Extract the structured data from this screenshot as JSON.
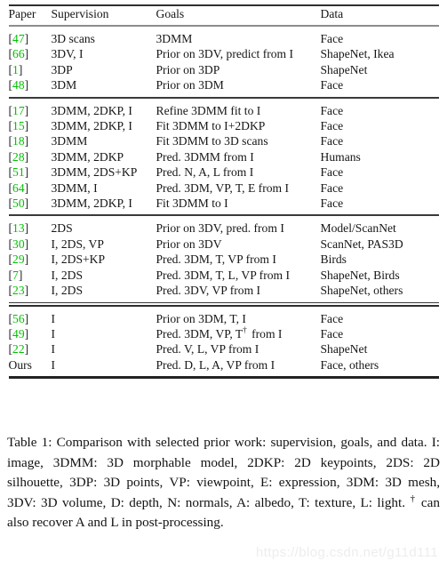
{
  "table": {
    "columns": [
      "Paper",
      "Supervision",
      "Goals",
      "Data"
    ],
    "groups": [
      {
        "rows": [
          {
            "paper": "[47]",
            "ref": "47",
            "is_ours": false,
            "supervision": "3D scans",
            "goals": "3DMM",
            "data": "Face"
          },
          {
            "paper": "[66]",
            "ref": "66",
            "is_ours": false,
            "supervision": "3DV, I",
            "goals": "Prior on 3DV, predict from I",
            "data": "ShapeNet, Ikea"
          },
          {
            "paper": "[1]",
            "ref": "1",
            "is_ours": false,
            "supervision": "3DP",
            "goals": "Prior on 3DP",
            "data": "ShapeNet"
          },
          {
            "paper": "[48]",
            "ref": "48",
            "is_ours": false,
            "supervision": "3DM",
            "goals": "Prior on 3DM",
            "data": "Face"
          }
        ]
      },
      {
        "rows": [
          {
            "paper": "[17]",
            "ref": "17",
            "is_ours": false,
            "supervision": "3DMM, 2DKP, I",
            "goals": "Refine 3DMM fit to I",
            "data": "Face"
          },
          {
            "paper": "[15]",
            "ref": "15",
            "is_ours": false,
            "supervision": "3DMM, 2DKP, I",
            "goals": "Fit 3DMM to I+2DKP",
            "data": "Face"
          },
          {
            "paper": "[18]",
            "ref": "18",
            "is_ours": false,
            "supervision": "3DMM",
            "goals": "Fit 3DMM to 3D scans",
            "data": "Face"
          },
          {
            "paper": "[28]",
            "ref": "28",
            "is_ours": false,
            "supervision": "3DMM, 2DKP",
            "goals": "Pred. 3DMM from I",
            "data": "Humans"
          },
          {
            "paper": "[51]",
            "ref": "51",
            "is_ours": false,
            "supervision": "3DMM, 2DS+KP",
            "goals": "Pred. N, A, L from I",
            "data": "Face"
          },
          {
            "paper": "[64]",
            "ref": "64",
            "is_ours": false,
            "supervision": "3DMM, I",
            "goals": "Pred. 3DM, VP, T, E from I",
            "data": "Face"
          },
          {
            "paper": "[50]",
            "ref": "50",
            "is_ours": false,
            "supervision": "3DMM, 2DKP, I",
            "goals": "Fit 3DMM to I",
            "data": "Face"
          }
        ]
      },
      {
        "rows": [
          {
            "paper": "[13]",
            "ref": "13",
            "is_ours": false,
            "supervision": "2DS",
            "goals": "Prior on 3DV, pred. from I",
            "data": "Model/ScanNet"
          },
          {
            "paper": "[30]",
            "ref": "30",
            "is_ours": false,
            "supervision": "I, 2DS, VP",
            "goals": "Prior on 3DV",
            "data": "ScanNet, PAS3D"
          },
          {
            "paper": "[29]",
            "ref": "29",
            "is_ours": false,
            "supervision": "I, 2DS+KP",
            "goals": "Pred. 3DM, T, VP from I",
            "data": "Birds"
          },
          {
            "paper": "[7]",
            "ref": "7",
            "is_ours": false,
            "supervision": "I, 2DS",
            "goals": "Pred. 3DM, T, L, VP from I",
            "data": "ShapeNet, Birds"
          },
          {
            "paper": "[23]",
            "ref": "23",
            "is_ours": false,
            "supervision": "I, 2DS",
            "goals": "Pred. 3DV, VP from I",
            "data": "ShapeNet, others"
          }
        ]
      },
      {
        "rows": [
          {
            "paper": "[56]",
            "ref": "56",
            "is_ours": false,
            "supervision": "I",
            "goals": "Prior on 3DM, T, I",
            "data": "Face"
          },
          {
            "paper": "[49]",
            "ref": "49",
            "is_ours": false,
            "supervision": "I",
            "goals_pre": "Pred. 3DM, VP, T",
            "goals_dagger": "†",
            "goals_post": " from I",
            "goals": "Pred. 3DM, VP, T† from I",
            "data": "Face"
          },
          {
            "paper": "[22]",
            "ref": "22",
            "is_ours": false,
            "supervision": "I",
            "goals": "Pred. V, L, VP from I",
            "data": "ShapeNet"
          },
          {
            "paper": "Ours",
            "ref": "",
            "is_ours": true,
            "supervision": "I",
            "goals": "Pred. D, L, A, VP from I",
            "data": "Face, others"
          }
        ]
      }
    ]
  },
  "caption": {
    "text_before_dagger": "Table 1: Comparison with selected prior work: supervision, goals, and data. I: image, 3DMM: 3D morphable model, 2DKP: 2D keypoints, 2DS: 2D silhouette, 3DP: 3D points, VP: viewpoint, E: expression, 3DM: 3D mesh, 3DV: 3D volume, D: depth, N: normals, A: albedo, T: texture, L: light. ",
    "dagger": "†",
    "text_after_dagger": " can also recover A and L in post-processing."
  },
  "watermark": {
    "text": "https://blog.csdn.net/g11d111"
  },
  "colors": {
    "citation_green": "#00c000",
    "text": "#161616",
    "rule_dark": "#2e2e2e",
    "rule_header": "#8d8d8d",
    "watermark": "#ededed"
  }
}
